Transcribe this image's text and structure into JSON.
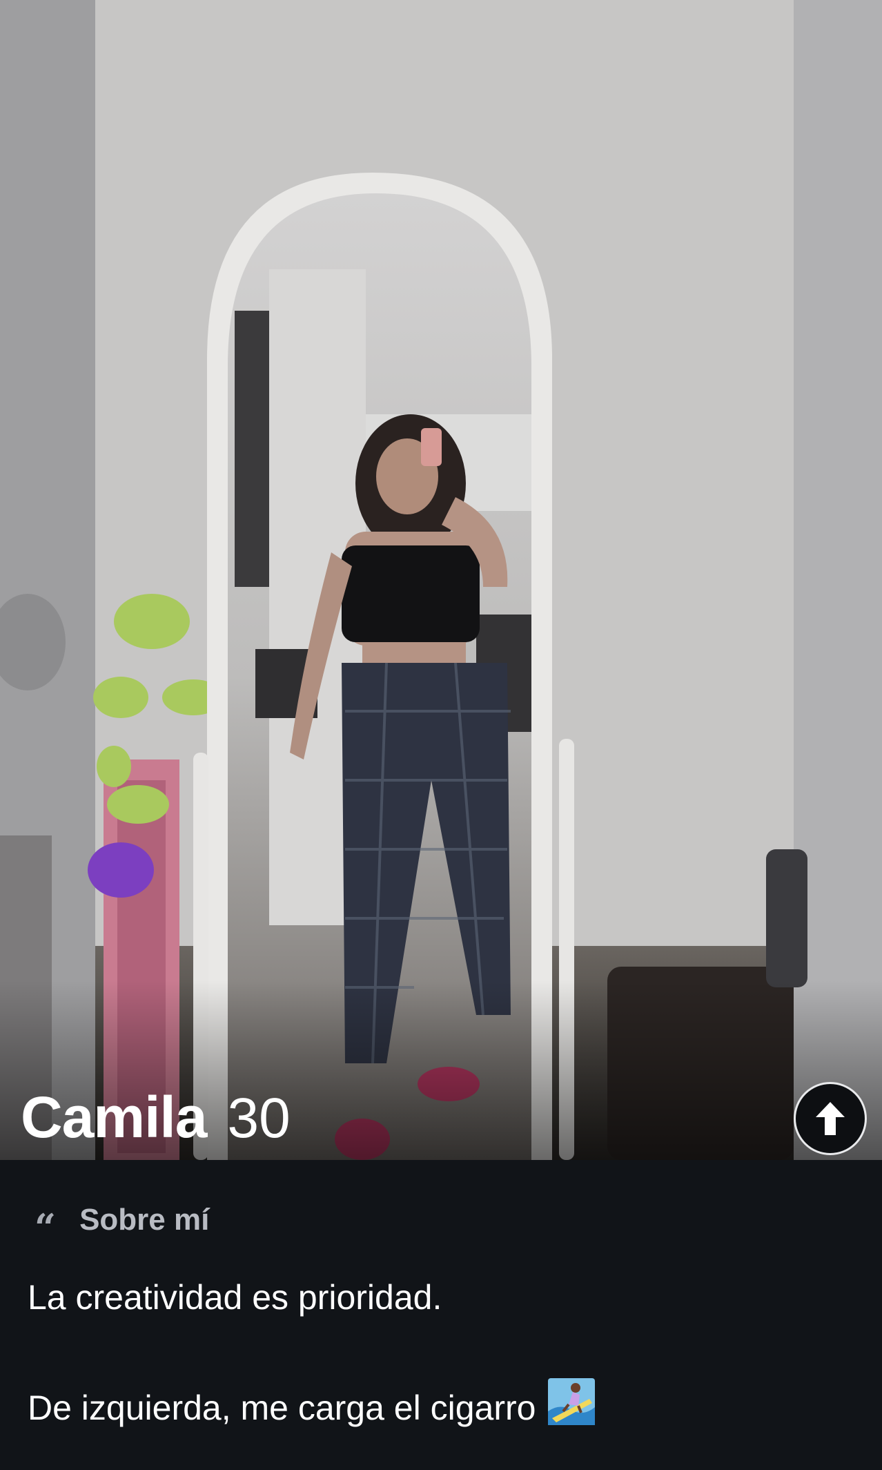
{
  "profile": {
    "name": "Camila",
    "age": "30"
  },
  "photo": {
    "icon": "profile-photo"
  },
  "expand_button": {
    "icon": "arrow-up-icon"
  },
  "bio": {
    "quote_icon": "“",
    "title": "Sobre mí",
    "line1": "La creatividad es prioridad.",
    "line2": "De izquierda, me carga el cigarro",
    "emoji": "surfer-emoji"
  },
  "colors": {
    "background": "#111418",
    "bio_title": "#b9bcc3",
    "text": "#ffffff"
  }
}
